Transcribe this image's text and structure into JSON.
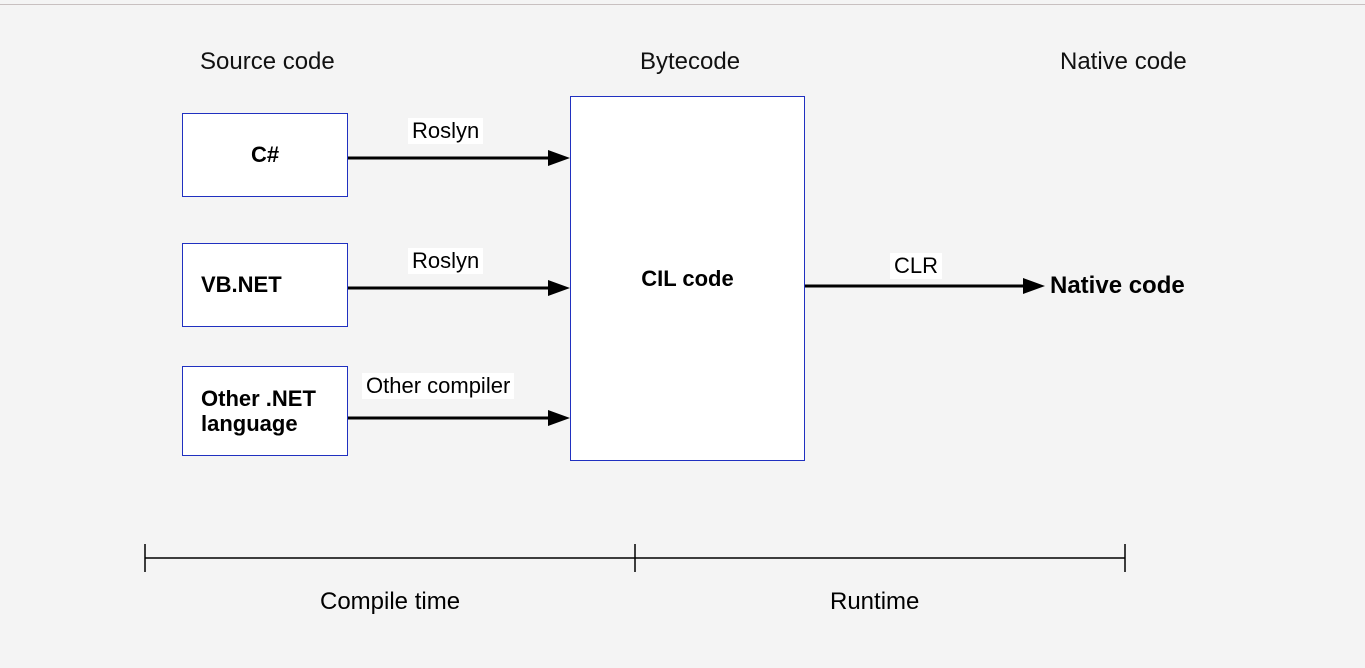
{
  "headers": {
    "source": "Source code",
    "bytecode": "Bytecode",
    "native": "Native code"
  },
  "source_boxes": {
    "csharp": "C#",
    "vbnet": "VB.NET",
    "other": "Other .NET language"
  },
  "cil_box": "CIL code",
  "arrows": {
    "roslyn1": "Roslyn",
    "roslyn2": "Roslyn",
    "other": "Other compiler",
    "clr": "CLR"
  },
  "native_text": "Native code",
  "timeline": {
    "compile": "Compile time",
    "runtime": "Runtime"
  }
}
